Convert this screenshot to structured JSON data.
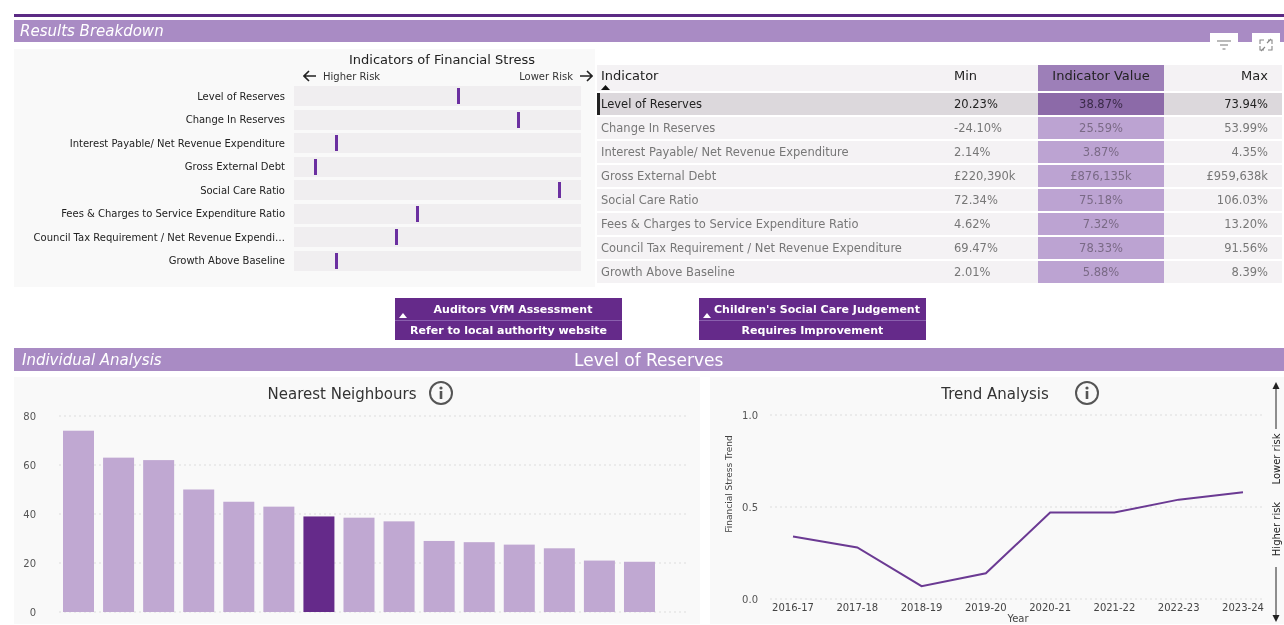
{
  "results_header": {
    "title": "Results Breakdown"
  },
  "toolbar": [
    {
      "kind": "filter"
    },
    {
      "kind": "expand"
    }
  ],
  "stress_panel": {
    "title": "Indicators of Financial Stress",
    "left_label": "Higher Risk",
    "right_label": "Lower Risk",
    "rows": [
      {
        "label": "Level of Reserves",
        "level": 0.57
      },
      {
        "label": "Change In Reserves",
        "level": 0.78
      },
      {
        "label": "Interest Payable/ Net Revenue Expenditure",
        "level": 0.146
      },
      {
        "label": "Gross External Debt",
        "level": 0.073
      },
      {
        "label": "Social Care Ratio",
        "level": 0.922
      },
      {
        "label": "Fees & Charges to Service Expenditure Ratio",
        "level": 0.43
      },
      {
        "label": "Council Tax Requirement / Net Revenue Expendi…",
        "level": 0.355
      },
      {
        "label": "Growth Above Baseline",
        "level": 0.146
      }
    ]
  },
  "table": {
    "columns": [
      {
        "label": "Indicator",
        "sorted": true
      },
      {
        "label": "Min",
        "sorted": false
      },
      {
        "label": "Indicator Value",
        "sorted": false
      },
      {
        "label": "Max",
        "sorted": false
      }
    ],
    "rows": [
      {
        "indicator": "Level of Reserves",
        "min": "20.23%",
        "value": "38.87%",
        "max": "73.94%",
        "selected": true
      },
      {
        "indicator": "Change In Reserves",
        "min": "-24.10%",
        "value": "25.59%",
        "max": "53.99%",
        "selected": false
      },
      {
        "indicator": "Interest Payable/ Net Revenue Expenditure",
        "min": "2.14%",
        "value": "3.87%",
        "max": "4.35%",
        "selected": false
      },
      {
        "indicator": "Gross External Debt",
        "min": "£220,390k",
        "value": "£876,135k",
        "max": "£959,638k",
        "selected": false
      },
      {
        "indicator": "Social Care Ratio",
        "min": "72.34%",
        "value": "75.18%",
        "max": "106.03%",
        "selected": false
      },
      {
        "indicator": "Fees & Charges to Service Expenditure Ratio",
        "min": "4.62%",
        "value": "7.32%",
        "max": "13.20%",
        "selected": false
      },
      {
        "indicator": "Council Tax Requirement / Net Revenue Expenditure",
        "min": "69.47%",
        "value": "78.33%",
        "max": "91.56%",
        "selected": false
      },
      {
        "indicator": "Growth Above Baseline",
        "min": "2.01%",
        "value": "5.88%",
        "max": "8.39%",
        "selected": false
      }
    ]
  },
  "cards": [
    {
      "title": "Auditors VfM Assessment",
      "value": "Refer to local authority website"
    },
    {
      "title": "Children's Social Care Judgement",
      "value": "Requires Improvement"
    }
  ],
  "analysis_header": {
    "title": "Individual Analysis",
    "subtitle": "Level of Reserves"
  },
  "nearest_neighbours": {
    "title": "Nearest Neighbours",
    "chart_data": {
      "type": "bar",
      "values": [
        74,
        63,
        62,
        50,
        45,
        43,
        39,
        38.5,
        37,
        29,
        28.5,
        27.5,
        26,
        21,
        20.5
      ],
      "colors": [
        "#c0a8d2",
        "#c0a8d2",
        "#c0a8d2",
        "#c0a8d2",
        "#c0a8d2",
        "#c0a8d2",
        "#652a8a",
        "#c0a8d2",
        "#c0a8d2",
        "#c0a8d2",
        "#c0a8d2",
        "#c0a8d2",
        "#c0a8d2",
        "#c0a8d2",
        "#c0a8d2"
      ],
      "ylim": [
        0,
        80
      ],
      "yticks": [
        0,
        20,
        40,
        60,
        80
      ],
      "grid": true
    }
  },
  "trend_analysis": {
    "title": "Trend Analysis",
    "risk_axis": {
      "up_label": "Lower risk",
      "down_label": "Higher risk"
    },
    "chart_data": {
      "type": "line",
      "xlabel": "Year",
      "ylabel": "Financial Stress Trend",
      "categories": [
        "2016-17",
        "2017-18",
        "2018-19",
        "2019-20",
        "2020-21",
        "2021-22",
        "2022-23",
        "2023-24"
      ],
      "series": [
        {
          "color": "#6b3a93",
          "values": [
            0.34,
            0.28,
            0.07,
            0.14,
            0.47,
            0.47,
            0.54,
            0.58
          ]
        }
      ],
      "ylim": [
        0,
        1
      ],
      "yticks": [
        {
          "value": 0,
          "label": "0.0"
        },
        {
          "value": 0.5,
          "label": "0.5"
        },
        {
          "value": 1,
          "label": "1.0"
        }
      ],
      "grid": true
    }
  }
}
